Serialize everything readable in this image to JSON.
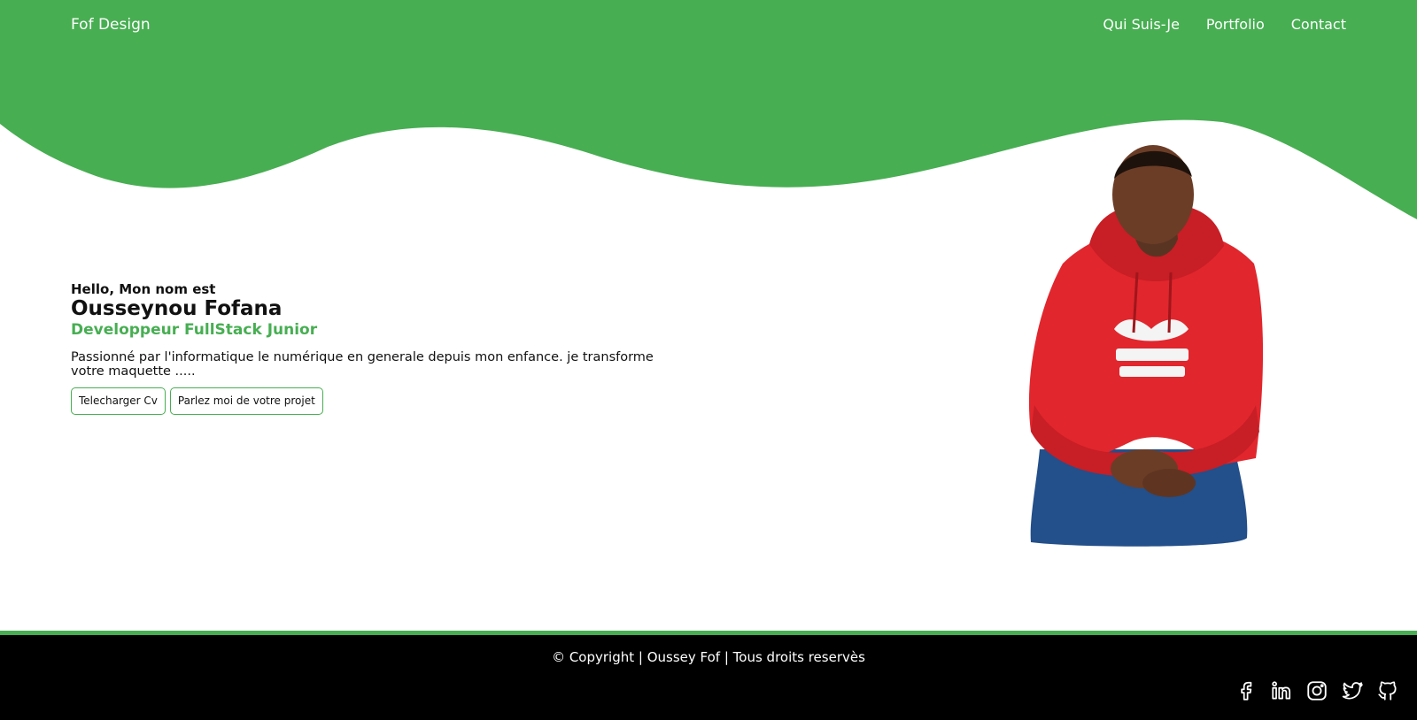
{
  "colors": {
    "accent": "#47ae52",
    "footer_bg": "#000000",
    "header_text": "#ffffff",
    "text": "#111111"
  },
  "header": {
    "logo": "Fof Design",
    "nav": [
      {
        "label": "Qui Suis-Je"
      },
      {
        "label": "Portfolio"
      },
      {
        "label": "Contact"
      }
    ]
  },
  "hero": {
    "intro": "Hello, Mon nom est",
    "name": "Ousseynou Fofana",
    "role": "Developpeur FullStack Junior",
    "description": "Passionné par l'informatique le numérique en generale depuis mon enfance. je transforme votre maquette .....",
    "buttons": [
      {
        "label": "Telecharger Cv"
      },
      {
        "label": "Parlez moi de votre projet"
      }
    ],
    "portrait_icon": "person-portrait-icon"
  },
  "footer": {
    "copyright": "© Copyright | Oussey Fof | Tous droits reservès",
    "socials": [
      {
        "icon": "facebook-icon"
      },
      {
        "icon": "linkedin-icon"
      },
      {
        "icon": "instagram-icon"
      },
      {
        "icon": "twitter-icon"
      },
      {
        "icon": "github-icon"
      }
    ]
  }
}
